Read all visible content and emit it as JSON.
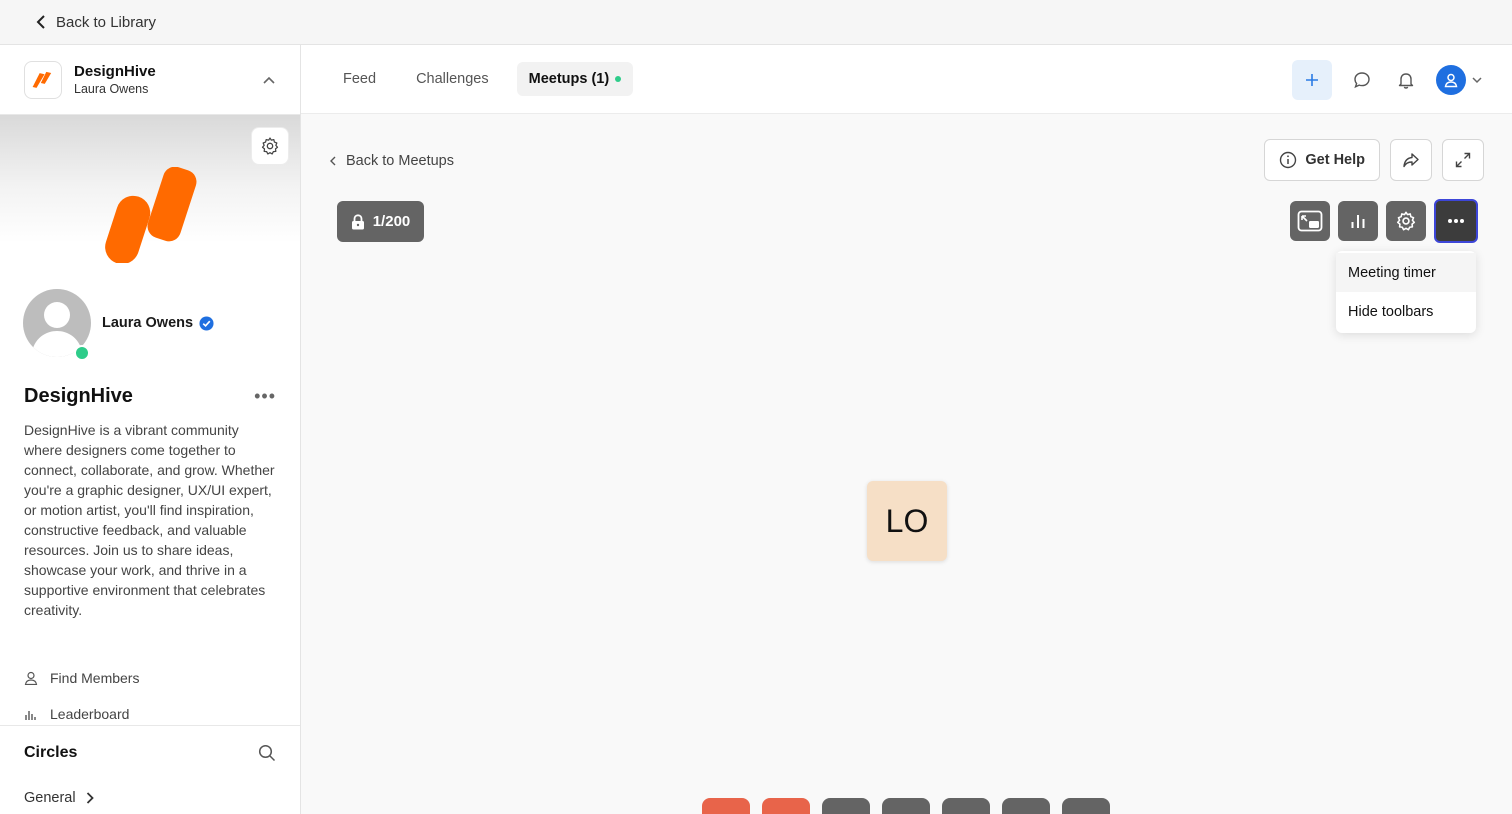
{
  "topbar": {
    "back_label": "Back to Library"
  },
  "community": {
    "name": "DesignHive",
    "user": "Laura Owens",
    "profile_name": "Laura Owens",
    "title": "DesignHive",
    "description": "DesignHive is a vibrant community where designers come together to connect, collaborate, and grow. Whether you're a graphic designer, UX/UI expert, or motion artist, you'll find inspiration, constructive feedback, and valuable resources. Join us to share ideas, showcase your work, and thrive in a supportive environment that celebrates creativity.",
    "links": [
      {
        "label": "Find Members",
        "icon": "user-icon"
      },
      {
        "label": "Leaderboard",
        "icon": "bar-chart-icon"
      }
    ],
    "circles_title": "Circles",
    "circles": [
      {
        "label": "General"
      }
    ]
  },
  "tabs": [
    {
      "label": "Feed"
    },
    {
      "label": "Challenges"
    },
    {
      "label": "Meetups (1)",
      "active": true
    }
  ],
  "meetup": {
    "back_label": "Back to Meetups",
    "get_help_label": "Get Help",
    "participants_count": "1/200",
    "menu_items": [
      "Meeting timer",
      "Hide toolbars"
    ],
    "participant_initials": "LO"
  },
  "colors": {
    "brand_orange": "#ff6a00",
    "online_green": "#2ecc8a",
    "accent_blue": "#1f6fe0",
    "tool_gray": "#646464",
    "focus_ring": "#3d46d8",
    "control_red": "#e8644a"
  }
}
